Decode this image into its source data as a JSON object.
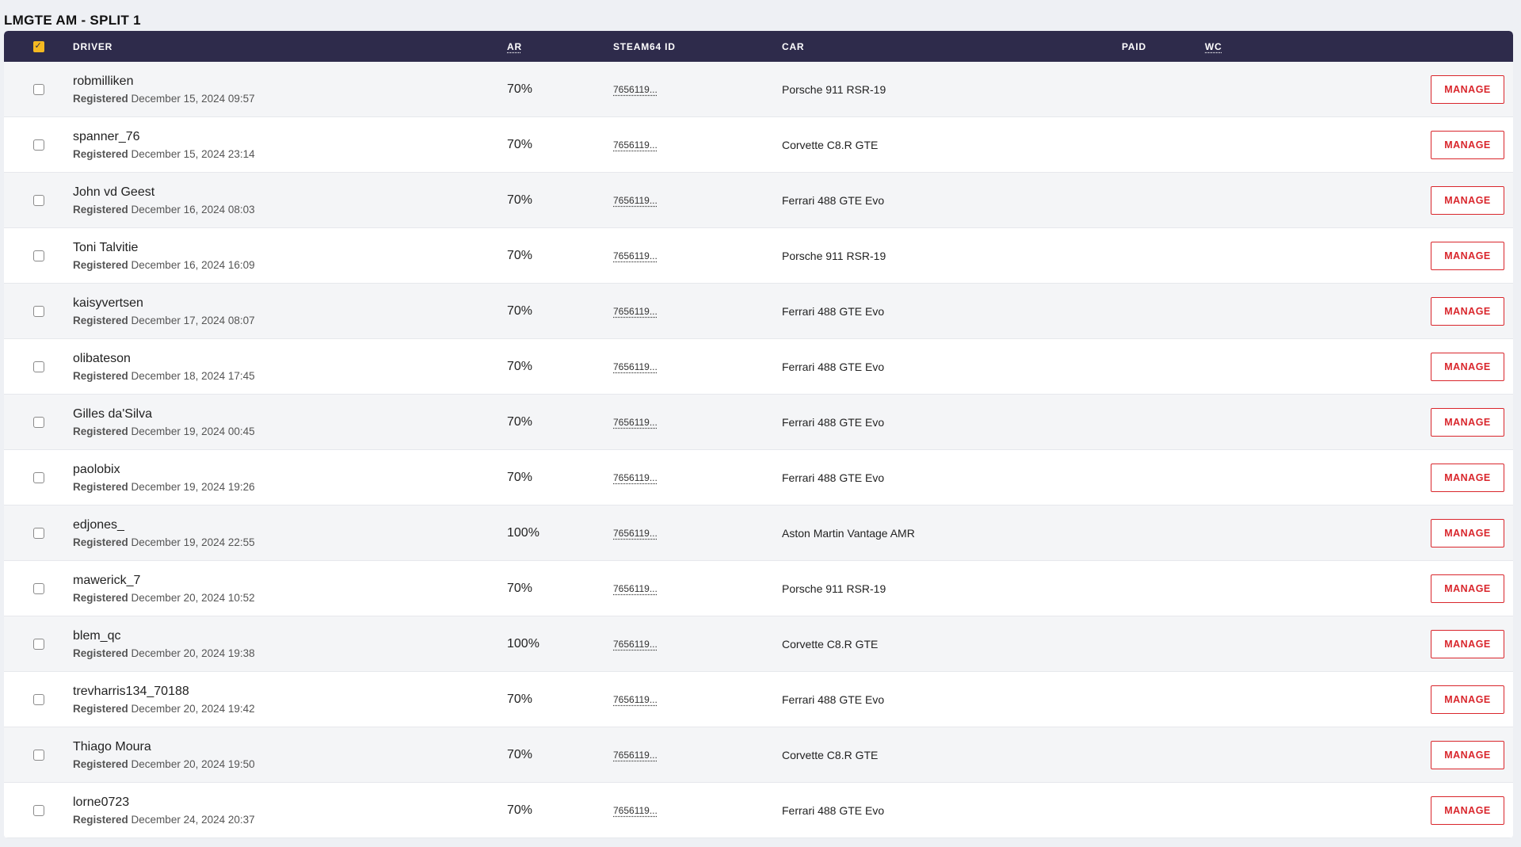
{
  "section": {
    "title": "LMGTE AM - SPLIT 1"
  },
  "headers": {
    "driver": "DRIVER",
    "ar": "AR",
    "steam": "STEAM64 ID",
    "car": "CAR",
    "paid": "PAID",
    "wc": "WC"
  },
  "registered_label": "Registered",
  "manage_label": "MANAGE",
  "colors": {
    "header_bg": "#2e2b4b",
    "accent": "#d9262c",
    "check": "#f5b921"
  },
  "rows": [
    {
      "driver": "robmilliken",
      "date": "December 15, 2024 09:57",
      "ar": "70%",
      "steam": "7656119...",
      "car": "Porsche 911 RSR-19"
    },
    {
      "driver": "spanner_76",
      "date": "December 15, 2024 23:14",
      "ar": "70%",
      "steam": "7656119...",
      "car": "Corvette C8.R GTE"
    },
    {
      "driver": "John vd Geest",
      "date": "December 16, 2024 08:03",
      "ar": "70%",
      "steam": "7656119...",
      "car": "Ferrari 488 GTE Evo"
    },
    {
      "driver": "Toni Talvitie",
      "date": "December 16, 2024 16:09",
      "ar": "70%",
      "steam": "7656119...",
      "car": "Porsche 911 RSR-19"
    },
    {
      "driver": "kaisyvertsen",
      "date": "December 17, 2024 08:07",
      "ar": "70%",
      "steam": "7656119...",
      "car": "Ferrari 488 GTE Evo"
    },
    {
      "driver": "olibateson",
      "date": "December 18, 2024 17:45",
      "ar": "70%",
      "steam": "7656119...",
      "car": "Ferrari 488 GTE Evo"
    },
    {
      "driver": "Gilles da'Silva",
      "date": "December 19, 2024 00:45",
      "ar": "70%",
      "steam": "7656119...",
      "car": "Ferrari 488 GTE Evo"
    },
    {
      "driver": "paolobix",
      "date": "December 19, 2024 19:26",
      "ar": "70%",
      "steam": "7656119...",
      "car": "Ferrari 488 GTE Evo"
    },
    {
      "driver": "edjones_",
      "date": "December 19, 2024 22:55",
      "ar": "100%",
      "steam": "7656119...",
      "car": "Aston Martin Vantage AMR"
    },
    {
      "driver": "mawerick_7",
      "date": "December 20, 2024 10:52",
      "ar": "70%",
      "steam": "7656119...",
      "car": "Porsche 911 RSR-19"
    },
    {
      "driver": "blem_qc",
      "date": "December 20, 2024 19:38",
      "ar": "100%",
      "steam": "7656119...",
      "car": "Corvette C8.R GTE"
    },
    {
      "driver": "trevharris134_70188",
      "date": "December 20, 2024 19:42",
      "ar": "70%",
      "steam": "7656119...",
      "car": "Ferrari 488 GTE Evo"
    },
    {
      "driver": "Thiago Moura",
      "date": "December 20, 2024 19:50",
      "ar": "70%",
      "steam": "7656119...",
      "car": "Corvette C8.R GTE"
    },
    {
      "driver": "lorne0723",
      "date": "December 24, 2024 20:37",
      "ar": "70%",
      "steam": "7656119...",
      "car": "Ferrari 488 GTE Evo"
    }
  ]
}
